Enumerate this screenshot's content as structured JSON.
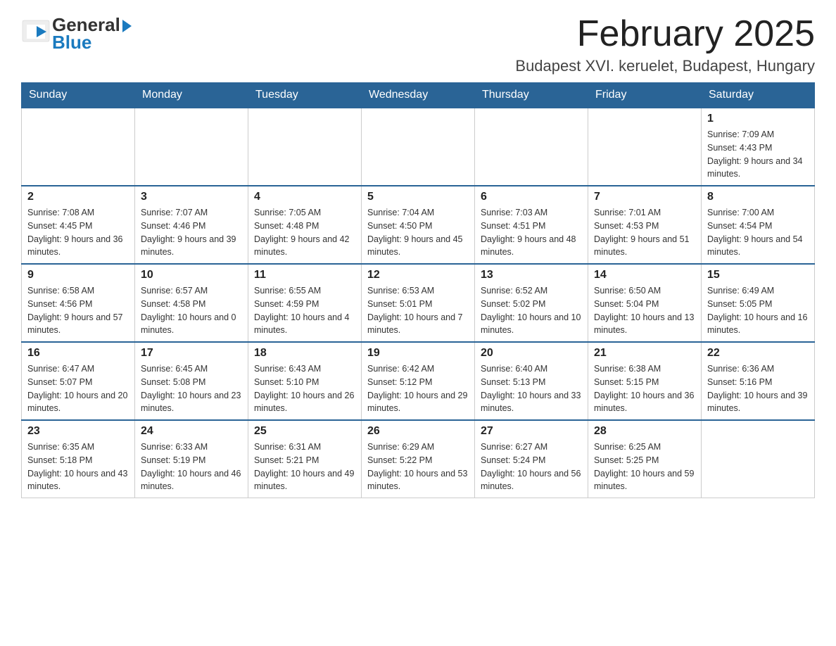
{
  "header": {
    "logo_general": "General",
    "logo_blue": "Blue",
    "month_title": "February 2025",
    "location": "Budapest XVI. keruelet, Budapest, Hungary"
  },
  "weekdays": [
    "Sunday",
    "Monday",
    "Tuesday",
    "Wednesday",
    "Thursday",
    "Friday",
    "Saturday"
  ],
  "weeks": [
    [
      {
        "day": "",
        "sunrise": "",
        "sunset": "",
        "daylight": ""
      },
      {
        "day": "",
        "sunrise": "",
        "sunset": "",
        "daylight": ""
      },
      {
        "day": "",
        "sunrise": "",
        "sunset": "",
        "daylight": ""
      },
      {
        "day": "",
        "sunrise": "",
        "sunset": "",
        "daylight": ""
      },
      {
        "day": "",
        "sunrise": "",
        "sunset": "",
        "daylight": ""
      },
      {
        "day": "",
        "sunrise": "",
        "sunset": "",
        "daylight": ""
      },
      {
        "day": "1",
        "sunrise": "Sunrise: 7:09 AM",
        "sunset": "Sunset: 4:43 PM",
        "daylight": "Daylight: 9 hours and 34 minutes."
      }
    ],
    [
      {
        "day": "2",
        "sunrise": "Sunrise: 7:08 AM",
        "sunset": "Sunset: 4:45 PM",
        "daylight": "Daylight: 9 hours and 36 minutes."
      },
      {
        "day": "3",
        "sunrise": "Sunrise: 7:07 AM",
        "sunset": "Sunset: 4:46 PM",
        "daylight": "Daylight: 9 hours and 39 minutes."
      },
      {
        "day": "4",
        "sunrise": "Sunrise: 7:05 AM",
        "sunset": "Sunset: 4:48 PM",
        "daylight": "Daylight: 9 hours and 42 minutes."
      },
      {
        "day": "5",
        "sunrise": "Sunrise: 7:04 AM",
        "sunset": "Sunset: 4:50 PM",
        "daylight": "Daylight: 9 hours and 45 minutes."
      },
      {
        "day": "6",
        "sunrise": "Sunrise: 7:03 AM",
        "sunset": "Sunset: 4:51 PM",
        "daylight": "Daylight: 9 hours and 48 minutes."
      },
      {
        "day": "7",
        "sunrise": "Sunrise: 7:01 AM",
        "sunset": "Sunset: 4:53 PM",
        "daylight": "Daylight: 9 hours and 51 minutes."
      },
      {
        "day": "8",
        "sunrise": "Sunrise: 7:00 AM",
        "sunset": "Sunset: 4:54 PM",
        "daylight": "Daylight: 9 hours and 54 minutes."
      }
    ],
    [
      {
        "day": "9",
        "sunrise": "Sunrise: 6:58 AM",
        "sunset": "Sunset: 4:56 PM",
        "daylight": "Daylight: 9 hours and 57 minutes."
      },
      {
        "day": "10",
        "sunrise": "Sunrise: 6:57 AM",
        "sunset": "Sunset: 4:58 PM",
        "daylight": "Daylight: 10 hours and 0 minutes."
      },
      {
        "day": "11",
        "sunrise": "Sunrise: 6:55 AM",
        "sunset": "Sunset: 4:59 PM",
        "daylight": "Daylight: 10 hours and 4 minutes."
      },
      {
        "day": "12",
        "sunrise": "Sunrise: 6:53 AM",
        "sunset": "Sunset: 5:01 PM",
        "daylight": "Daylight: 10 hours and 7 minutes."
      },
      {
        "day": "13",
        "sunrise": "Sunrise: 6:52 AM",
        "sunset": "Sunset: 5:02 PM",
        "daylight": "Daylight: 10 hours and 10 minutes."
      },
      {
        "day": "14",
        "sunrise": "Sunrise: 6:50 AM",
        "sunset": "Sunset: 5:04 PM",
        "daylight": "Daylight: 10 hours and 13 minutes."
      },
      {
        "day": "15",
        "sunrise": "Sunrise: 6:49 AM",
        "sunset": "Sunset: 5:05 PM",
        "daylight": "Daylight: 10 hours and 16 minutes."
      }
    ],
    [
      {
        "day": "16",
        "sunrise": "Sunrise: 6:47 AM",
        "sunset": "Sunset: 5:07 PM",
        "daylight": "Daylight: 10 hours and 20 minutes."
      },
      {
        "day": "17",
        "sunrise": "Sunrise: 6:45 AM",
        "sunset": "Sunset: 5:08 PM",
        "daylight": "Daylight: 10 hours and 23 minutes."
      },
      {
        "day": "18",
        "sunrise": "Sunrise: 6:43 AM",
        "sunset": "Sunset: 5:10 PM",
        "daylight": "Daylight: 10 hours and 26 minutes."
      },
      {
        "day": "19",
        "sunrise": "Sunrise: 6:42 AM",
        "sunset": "Sunset: 5:12 PM",
        "daylight": "Daylight: 10 hours and 29 minutes."
      },
      {
        "day": "20",
        "sunrise": "Sunrise: 6:40 AM",
        "sunset": "Sunset: 5:13 PM",
        "daylight": "Daylight: 10 hours and 33 minutes."
      },
      {
        "day": "21",
        "sunrise": "Sunrise: 6:38 AM",
        "sunset": "Sunset: 5:15 PM",
        "daylight": "Daylight: 10 hours and 36 minutes."
      },
      {
        "day": "22",
        "sunrise": "Sunrise: 6:36 AM",
        "sunset": "Sunset: 5:16 PM",
        "daylight": "Daylight: 10 hours and 39 minutes."
      }
    ],
    [
      {
        "day": "23",
        "sunrise": "Sunrise: 6:35 AM",
        "sunset": "Sunset: 5:18 PM",
        "daylight": "Daylight: 10 hours and 43 minutes."
      },
      {
        "day": "24",
        "sunrise": "Sunrise: 6:33 AM",
        "sunset": "Sunset: 5:19 PM",
        "daylight": "Daylight: 10 hours and 46 minutes."
      },
      {
        "day": "25",
        "sunrise": "Sunrise: 6:31 AM",
        "sunset": "Sunset: 5:21 PM",
        "daylight": "Daylight: 10 hours and 49 minutes."
      },
      {
        "day": "26",
        "sunrise": "Sunrise: 6:29 AM",
        "sunset": "Sunset: 5:22 PM",
        "daylight": "Daylight: 10 hours and 53 minutes."
      },
      {
        "day": "27",
        "sunrise": "Sunrise: 6:27 AM",
        "sunset": "Sunset: 5:24 PM",
        "daylight": "Daylight: 10 hours and 56 minutes."
      },
      {
        "day": "28",
        "sunrise": "Sunrise: 6:25 AM",
        "sunset": "Sunset: 5:25 PM",
        "daylight": "Daylight: 10 hours and 59 minutes."
      },
      {
        "day": "",
        "sunrise": "",
        "sunset": "",
        "daylight": ""
      }
    ]
  ]
}
